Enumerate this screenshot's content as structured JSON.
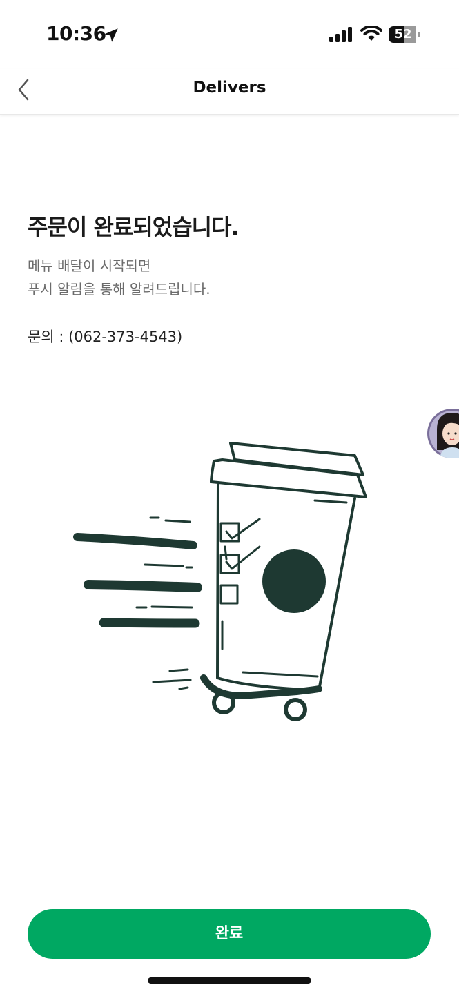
{
  "status_bar": {
    "time": "10:36",
    "battery": "52",
    "icons": [
      "location-arrow-icon",
      "signal-icon",
      "wifi-icon",
      "battery-icon"
    ]
  },
  "nav": {
    "title": "Delivers",
    "back_icon": "chevron-left-icon"
  },
  "content": {
    "headline": "주문이 완료되었습니다.",
    "description_line1": "메뉴 배달이 시작되면",
    "description_line2": "푸시 알림을 통해 알려드립니다.",
    "contact": "문의 : (062-373-4543)"
  },
  "illustration": {
    "name": "delivery-cup-on-skateboard",
    "color": "#1e3932"
  },
  "footer": {
    "done_label": "완료"
  },
  "colors": {
    "accent": "#00a862",
    "illustration": "#1e3932"
  }
}
